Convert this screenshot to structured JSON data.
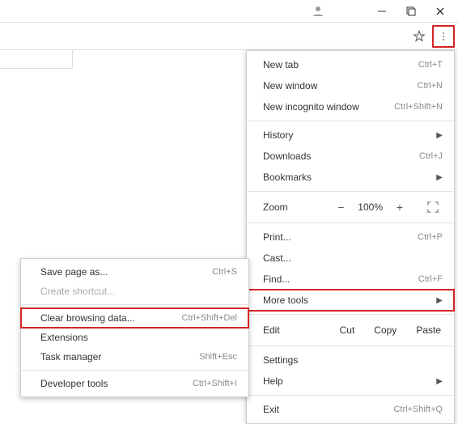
{
  "menu": {
    "new_tab": {
      "label": "New tab",
      "shortcut": "Ctrl+T"
    },
    "new_window": {
      "label": "New window",
      "shortcut": "Ctrl+N"
    },
    "new_incognito": {
      "label": "New incognito window",
      "shortcut": "Ctrl+Shift+N"
    },
    "history": {
      "label": "History"
    },
    "downloads": {
      "label": "Downloads",
      "shortcut": "Ctrl+J"
    },
    "bookmarks": {
      "label": "Bookmarks"
    },
    "zoom_label": "Zoom",
    "zoom_minus": "−",
    "zoom_value": "100%",
    "zoom_plus": "+",
    "print": {
      "label": "Print...",
      "shortcut": "Ctrl+P"
    },
    "cast": {
      "label": "Cast..."
    },
    "find": {
      "label": "Find...",
      "shortcut": "Ctrl+F"
    },
    "more_tools": {
      "label": "More tools"
    },
    "edit_label": "Edit",
    "cut": "Cut",
    "copy": "Copy",
    "paste": "Paste",
    "settings": {
      "label": "Settings"
    },
    "help": {
      "label": "Help"
    },
    "exit": {
      "label": "Exit",
      "shortcut": "Ctrl+Shift+Q"
    }
  },
  "submenu": {
    "save_page": {
      "label": "Save page as...",
      "shortcut": "Ctrl+S"
    },
    "create_shortcut": {
      "label": "Create shortcut..."
    },
    "clear_data": {
      "label": "Clear browsing data...",
      "shortcut": "Ctrl+Shift+Del"
    },
    "extensions": {
      "label": "Extensions"
    },
    "task_manager": {
      "label": "Task manager",
      "shortcut": "Shift+Esc"
    },
    "dev_tools": {
      "label": "Developer tools",
      "shortcut": "Ctrl+Shift+I"
    }
  }
}
